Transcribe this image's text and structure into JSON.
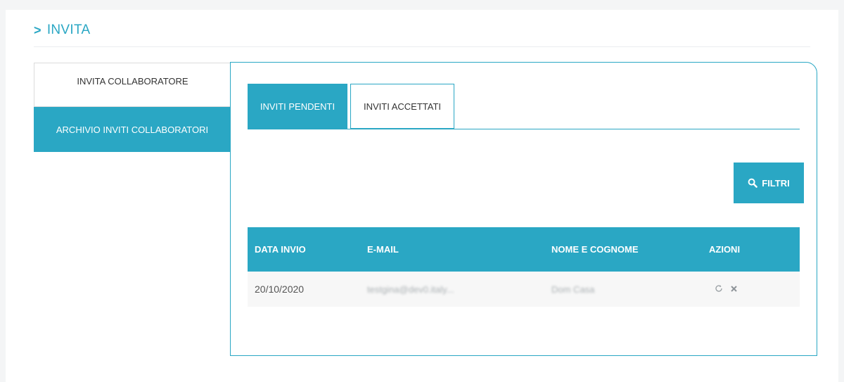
{
  "header": {
    "chevron": ">",
    "title": "INVITA"
  },
  "sidebar": {
    "items": [
      {
        "label": "INVITA COLLABORATORE"
      },
      {
        "label": "ARCHIVIO INVITI COLLABORATORI"
      }
    ]
  },
  "tabs": [
    {
      "label": "INVITI PENDENTI"
    },
    {
      "label": "INVITI ACCETTATI"
    }
  ],
  "filter": {
    "label": "FILTRI",
    "icon": "search-icon"
  },
  "table": {
    "columns": [
      "DATA INVIO",
      "E-MAIL",
      "NOME E COGNOME",
      "AZIONI"
    ],
    "rows": [
      {
        "date": "20/10/2020",
        "email": "testgina@dev0.italy...",
        "name": "Dom Casa"
      }
    ]
  },
  "actions": {
    "resend_icon": "refresh-icon",
    "delete_icon": "close-icon"
  },
  "colors": {
    "accent": "#2aa7c4",
    "row_bg": "#f7f7f7",
    "page_bg": "#f4f5f6"
  }
}
